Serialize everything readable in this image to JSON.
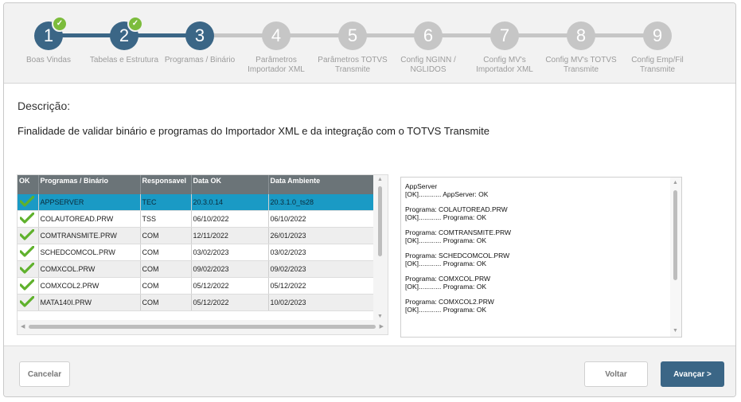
{
  "wizard": {
    "steps": [
      {
        "number": "1",
        "label": "Boas Vindas",
        "status": "done"
      },
      {
        "number": "2",
        "label": "Tabelas e Estrutura",
        "status": "done"
      },
      {
        "number": "3",
        "label": "Programas / Binário",
        "status": "current"
      },
      {
        "number": "4",
        "label": "Parâmetros Importador XML",
        "status": "pending"
      },
      {
        "number": "5",
        "label": "Parâmetros TOTVS Transmite",
        "status": "pending"
      },
      {
        "number": "6",
        "label": "Config NGINN / NGLIDOS",
        "status": "pending"
      },
      {
        "number": "7",
        "label": "Config MV's Importador XML",
        "status": "pending"
      },
      {
        "number": "8",
        "label": "Config MV's TOTVS Transmite",
        "status": "pending"
      },
      {
        "number": "9",
        "label": "Config Emp/Fil Transmite",
        "status": "pending"
      }
    ]
  },
  "content": {
    "description_label": "Descrição:",
    "description_text": "Finalidade de validar binário e programas do Importador XML e da integração com o TOTVS Transmite"
  },
  "grid": {
    "headers": [
      "OK",
      "Programas / Binário",
      "Responsavel",
      "Data OK",
      "Data Ambiente"
    ],
    "rows": [
      {
        "program": "APPSERVER",
        "responsavel": "TEC",
        "data_ok": "20.3.0.14",
        "data_ambiente": "20.3.1.0_ts28",
        "selected": true
      },
      {
        "program": "COLAUTOREAD.PRW",
        "responsavel": "TSS",
        "data_ok": "06/10/2022",
        "data_ambiente": "06/10/2022"
      },
      {
        "program": "COMTRANSMITE.PRW",
        "responsavel": "COM",
        "data_ok": "12/11/2022",
        "data_ambiente": "26/01/2023"
      },
      {
        "program": "SCHEDCOMCOL.PRW",
        "responsavel": "COM",
        "data_ok": "03/02/2023",
        "data_ambiente": "03/02/2023"
      },
      {
        "program": "COMXCOL.PRW",
        "responsavel": "COM",
        "data_ok": "09/02/2023",
        "data_ambiente": "09/02/2023"
      },
      {
        "program": "COMXCOL2.PRW",
        "responsavel": "COM",
        "data_ok": "05/12/2022",
        "data_ambiente": "05/12/2022"
      },
      {
        "program": "MATA140I.PRW",
        "responsavel": "COM",
        "data_ok": "05/12/2022",
        "data_ambiente": "10/02/2023"
      }
    ]
  },
  "log": {
    "entries": [
      {
        "title": "AppServer",
        "result": "[OK]............ AppServer: OK"
      },
      {
        "title": "Programa: COLAUTOREAD.PRW",
        "result": "[OK]............ Programa: OK"
      },
      {
        "title": "Programa: COMTRANSMITE.PRW",
        "result": "[OK]............ Programa: OK"
      },
      {
        "title": "Programa: SCHEDCOMCOL.PRW",
        "result": "[OK]............ Programa: OK"
      },
      {
        "title": "Programa: COMXCOL.PRW",
        "result": "[OK]............ Programa: OK"
      },
      {
        "title": "Programa: COMXCOL2.PRW",
        "result": "[OK]............ Programa: OK"
      }
    ]
  },
  "footer": {
    "cancel_label": "Cancelar",
    "back_label": "Voltar",
    "next_label": "Avançar >"
  },
  "colors": {
    "active": "#3b6686",
    "pending": "#c6c6c6",
    "check": "#7cbc3c",
    "selected_row": "#1a9ac5"
  }
}
